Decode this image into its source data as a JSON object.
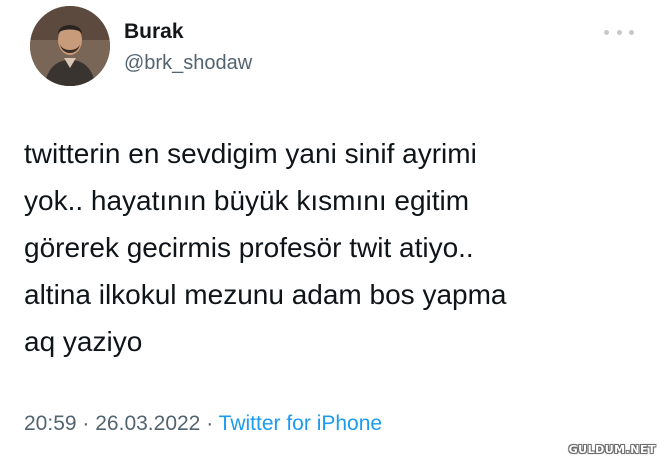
{
  "user": {
    "display_name": "Burak",
    "handle": "@brk_shodaw",
    "avatar_icon": "profile-photo"
  },
  "more_icon": "ellipsis-icon",
  "tweet": {
    "text": "twitterin en sevdigim yani sinif ayrimi\nyok.. hayatının büyük kısmını egitim\ngörerek gecirmis profesör twit atiyo..\naltina ilkokul mezunu adam bos yapma\naq yaziyo"
  },
  "meta": {
    "time": "20:59",
    "separator": "·",
    "date": "26.03.2022",
    "source": "Twitter for iPhone"
  },
  "watermark": "GULDUM.NET",
  "colors": {
    "text": "#0f1419",
    "secondary": "#536471",
    "link": "#1d9bf0"
  }
}
